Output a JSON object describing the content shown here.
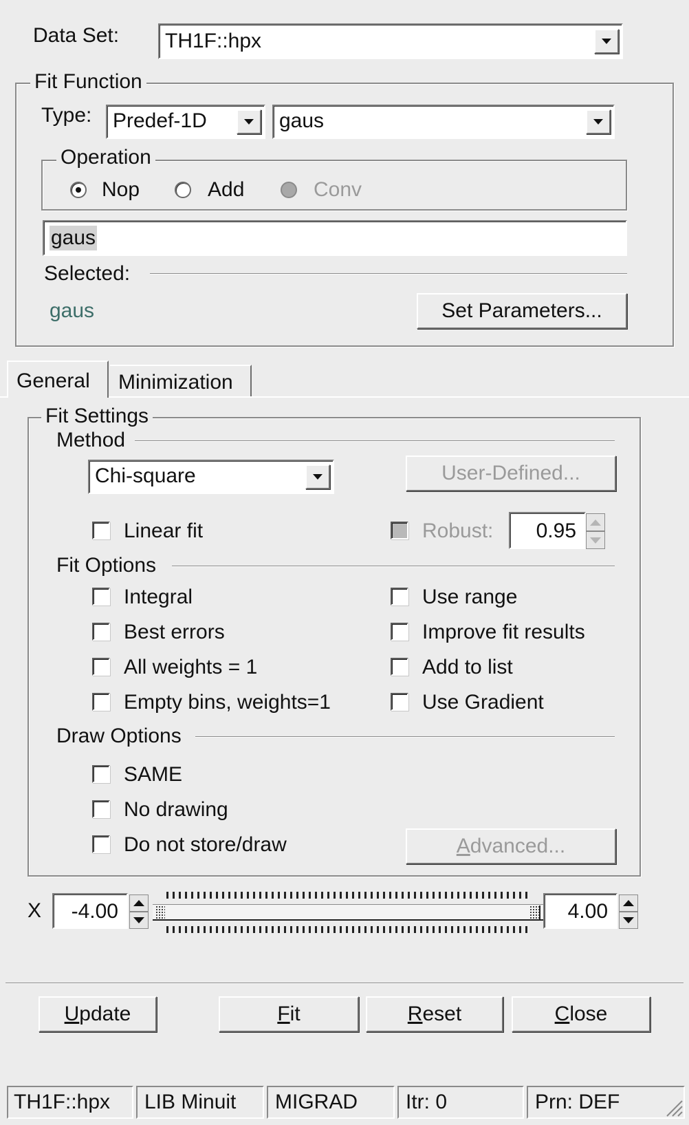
{
  "dataset": {
    "label": "Data Set:",
    "value": "TH1F::hpx"
  },
  "fit_function": {
    "title": "Fit Function",
    "type_label": "Type:",
    "type_value": "Predef-1D",
    "function_value": "gaus",
    "operation": {
      "title": "Operation",
      "options": [
        {
          "label": "Nop",
          "selected": true,
          "enabled": true
        },
        {
          "label": "Add",
          "selected": false,
          "enabled": true
        },
        {
          "label": "Conv",
          "selected": false,
          "enabled": false
        }
      ]
    },
    "formula_value": "gaus",
    "selected_label": "Selected:",
    "selected_value": "gaus",
    "set_parameters_label": "Set Parameters..."
  },
  "tabs": [
    {
      "label": "General",
      "active": true
    },
    {
      "label": "Minimization",
      "active": false
    }
  ],
  "fit_settings": {
    "title": "Fit Settings",
    "method_title": "Method",
    "method_value": "Chi-square",
    "user_defined_label": "User-Defined...",
    "linear_fit_label": "Linear fit",
    "robust_label": "Robust:",
    "robust_value": "0.95",
    "fit_options_title": "Fit Options",
    "fit_options_left": [
      "Integral",
      "Best errors",
      "All weights = 1",
      "Empty bins, weights=1"
    ],
    "fit_options_right": [
      "Use range",
      "Improve fit results",
      "Add to list",
      "Use Gradient"
    ],
    "draw_options_title": "Draw Options",
    "draw_options": [
      "SAME",
      "No drawing",
      "Do not store/draw"
    ],
    "advanced_label_first": "A",
    "advanced_label_rest": "dvanced..."
  },
  "range": {
    "axis_label": "X",
    "min_value": "-4.00",
    "max_value": "4.00"
  },
  "buttons": {
    "update": {
      "first": "U",
      "rest": "pdate"
    },
    "fit": {
      "first": "F",
      "rest": "it"
    },
    "reset": {
      "first": "R",
      "rest": "eset"
    },
    "close": {
      "first": "C",
      "rest": "lose"
    }
  },
  "status_bar": [
    "TH1F::hpx",
    "LIB Minuit",
    "MIGRAD",
    "Itr: 0",
    "Prn: DEF"
  ]
}
